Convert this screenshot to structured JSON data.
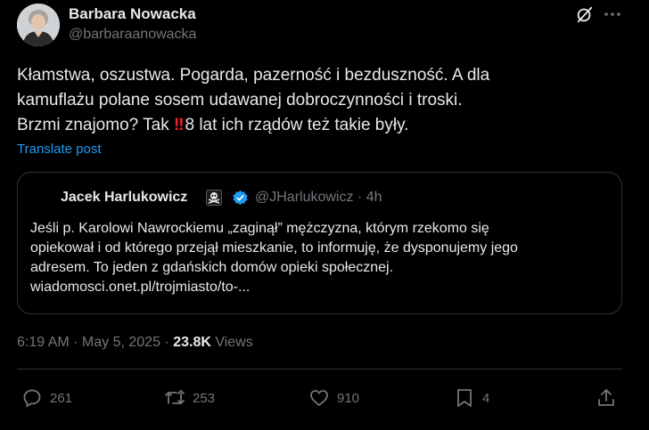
{
  "author": {
    "name": "Barbara Nowacka",
    "handle": "@barbaraanowacka"
  },
  "post": {
    "line1": "Kłamstwa, oszustwa. Pogarda, pazerność i bezduszność. A dla",
    "line2": "kamuflażu  polane sosem udawanej dobroczynności i troski.",
    "line3_before": "Brzmi znajomo? Tak ",
    "line3_emoji": "‼",
    "line3_after": "8 lat ich rządów też takie były."
  },
  "translate_label": "Translate post",
  "quote": {
    "name": "Jacek Harlukowicz",
    "handle_time": "@JHarlukowicz · 4h",
    "lines": [
      "Jeśli p. Karolowi Nawrockiemu „zaginął” mężczyzna, którym rzekomo się",
      "opiekował i od którego przejął mieszkanie, to informuję, że dysponujemy jego",
      "adresem. To jeden z gdańskich domów opieki społecznej.",
      "wiadomosci.onet.pl/trojmiasto/to-..."
    ]
  },
  "meta": {
    "time_date": "6:19 AM · May 5, 2025 · ",
    "views_count": "23.8K",
    "views_label": " Views"
  },
  "actions": {
    "replies": "261",
    "reposts": "253",
    "likes": "910",
    "bookmarks": "4"
  },
  "colors": {
    "background": "#000000",
    "text": "#e7e9ea",
    "muted": "#71767b",
    "link": "#1d9bf0",
    "border": "#2f3336",
    "verified": "#1d9bf0"
  }
}
